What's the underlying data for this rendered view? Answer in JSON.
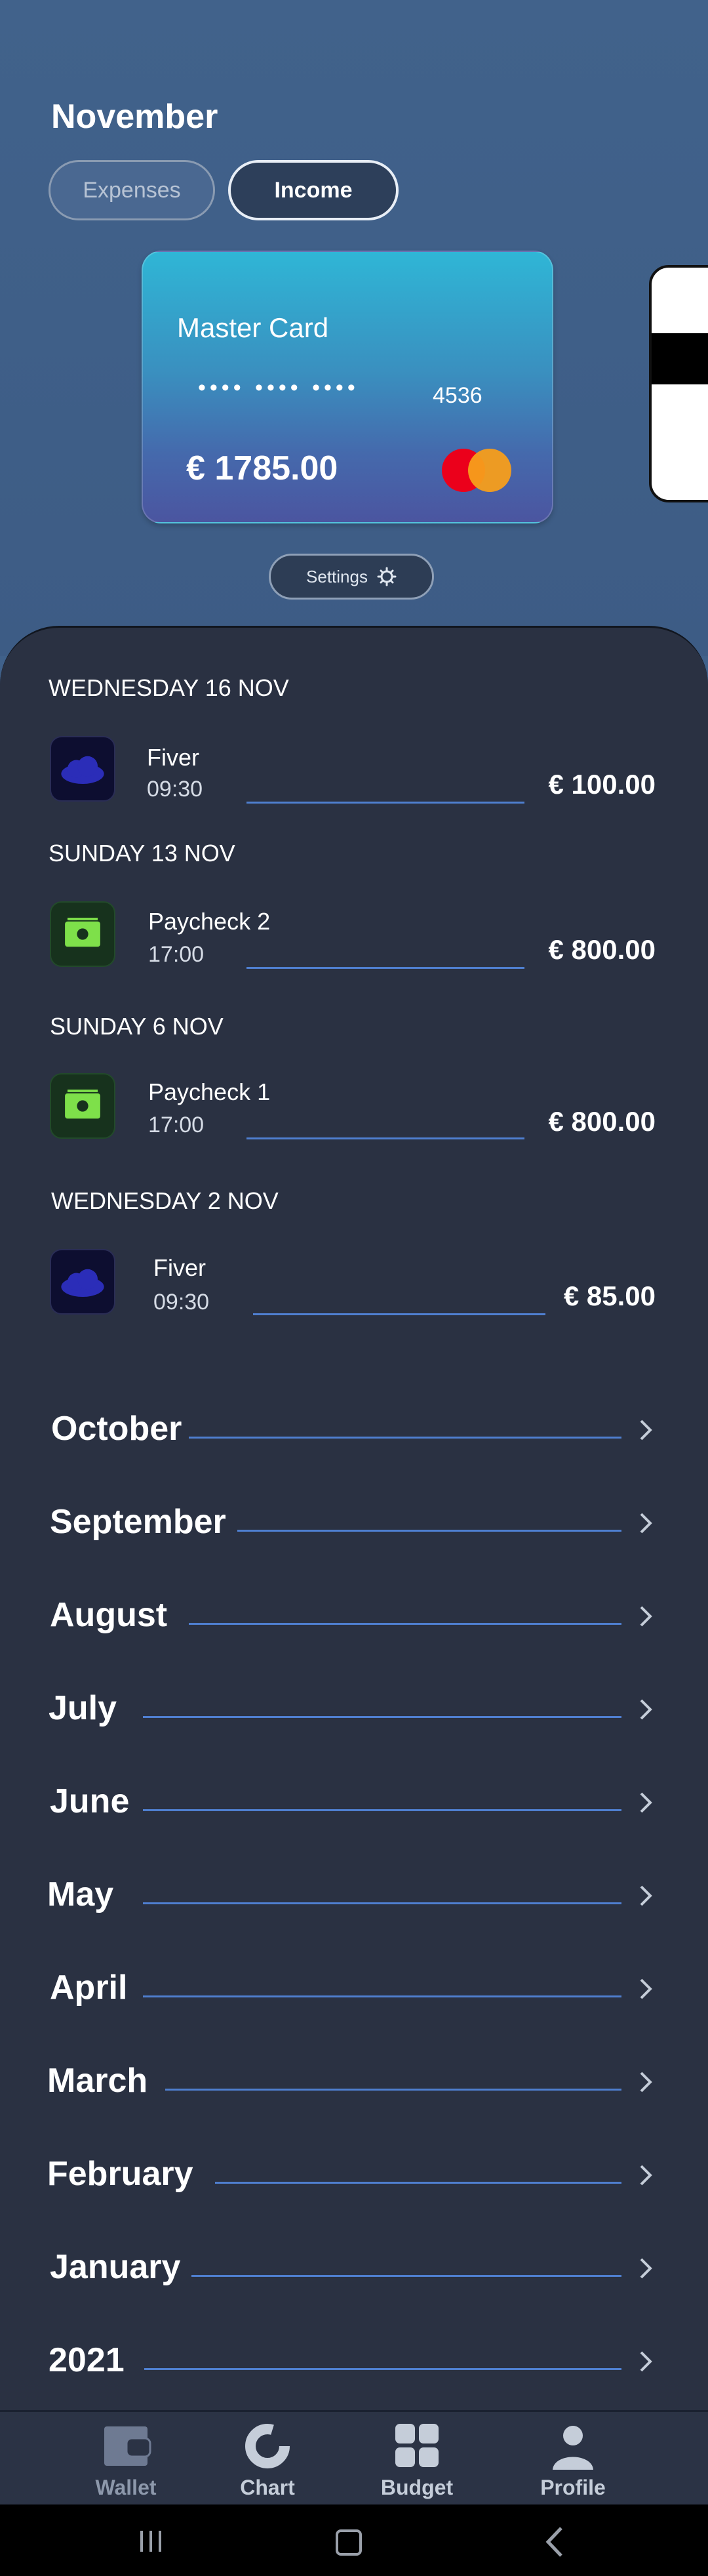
{
  "header": {
    "month": "November",
    "tabs": [
      {
        "label": "Expenses"
      },
      {
        "label": "Income"
      }
    ],
    "active_tab": "Income"
  },
  "card": {
    "name": "Master Card",
    "masked_number": "•••• •••• ••••",
    "last_digits": "4536",
    "balance": "€ 1785.00",
    "brand_icon": "mastercard-logo"
  },
  "settings_button": {
    "label": "Settings",
    "icon": "gear-icon"
  },
  "transactions": [
    {
      "day": "WEDNESDAY 16 NOV",
      "title": "Fiver",
      "time": "09:30",
      "amount": "€ 100.00",
      "icon": "cloud-icon"
    },
    {
      "day": "SUNDAY 13 NOV",
      "title": "Paycheck 2",
      "time": "17:00",
      "amount": "€ 800.00",
      "icon": "cash-icon"
    },
    {
      "day": "SUNDAY 6 NOV",
      "title": "Paycheck 1",
      "time": "17:00",
      "amount": "€ 800.00",
      "icon": "cash-icon"
    },
    {
      "day": "WEDNESDAY 2 NOV",
      "title": "Fiver",
      "time": "09:30",
      "amount": "€ 85.00",
      "icon": "cloud-icon"
    }
  ],
  "months": [
    "October",
    "September",
    "August",
    "July",
    "June",
    "May",
    "April",
    "March",
    "February",
    "January",
    "2021"
  ],
  "nav": [
    {
      "label": "Wallet",
      "icon": "wallet-icon",
      "active": true
    },
    {
      "label": "Chart",
      "icon": "donut-chart-icon"
    },
    {
      "label": "Budget",
      "icon": "grid-icon"
    },
    {
      "label": "Profile",
      "icon": "person-icon"
    }
  ],
  "colors": {
    "accent_line": "#4f7fd0",
    "panel": "#2a3142",
    "header_bg": "#40618a",
    "cash_green": "#7ee04a",
    "cloud_blue": "#2b2db8"
  }
}
